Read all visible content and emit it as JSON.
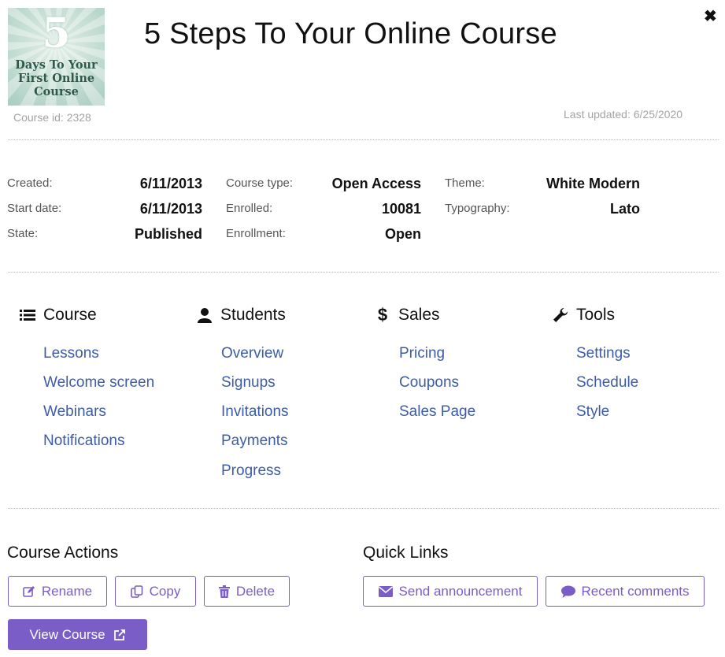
{
  "thumbnail": {
    "number": "5",
    "caption_lines": [
      "Days To Your",
      "First Online",
      "Course"
    ]
  },
  "course_id": "Course id: 2328",
  "title": "5 Steps To Your Online Course",
  "close_glyph": "✖",
  "last_updated": "Last updated: 6/25/2020",
  "meta": {
    "col1": [
      {
        "label": "Created:",
        "value": "6/11/2013"
      },
      {
        "label": "Start date:",
        "value": "6/11/2013"
      },
      {
        "label": "State:",
        "value": "Published"
      }
    ],
    "col2": [
      {
        "label": "Course type:",
        "value": "Open Access"
      },
      {
        "label": "Enrolled:",
        "value": "10081"
      },
      {
        "label": "Enrollment:",
        "value": "Open"
      }
    ],
    "col3": [
      {
        "label": "Theme:",
        "value": "White Modern"
      },
      {
        "label": "Typography:",
        "value": "Lato"
      }
    ]
  },
  "sections": [
    {
      "title": "Course",
      "icon": "list-icon",
      "links": [
        "Lessons",
        "Welcome screen",
        "Webinars",
        "Notifications"
      ]
    },
    {
      "title": "Students",
      "icon": "user-icon",
      "links": [
        "Overview",
        "Signups",
        "Invitations",
        "Payments",
        "Progress"
      ]
    },
    {
      "title": "Sales",
      "icon": "dollar-icon",
      "links": [
        "Pricing",
        "Coupons",
        "Sales Page"
      ]
    },
    {
      "title": "Tools",
      "icon": "wrench-icon",
      "links": [
        "Settings",
        "Schedule",
        "Style"
      ]
    }
  ],
  "course_actions": {
    "title": "Course Actions",
    "rename": "Rename",
    "copy": "Copy",
    "delete": "Delete",
    "view_course": "View Course"
  },
  "quick_links": {
    "title": "Quick Links",
    "send_announcement": "Send announcement",
    "recent_comments": "Recent comments"
  },
  "colors": {
    "accent": "#7b5dc7",
    "link": "#3d5ca8"
  }
}
